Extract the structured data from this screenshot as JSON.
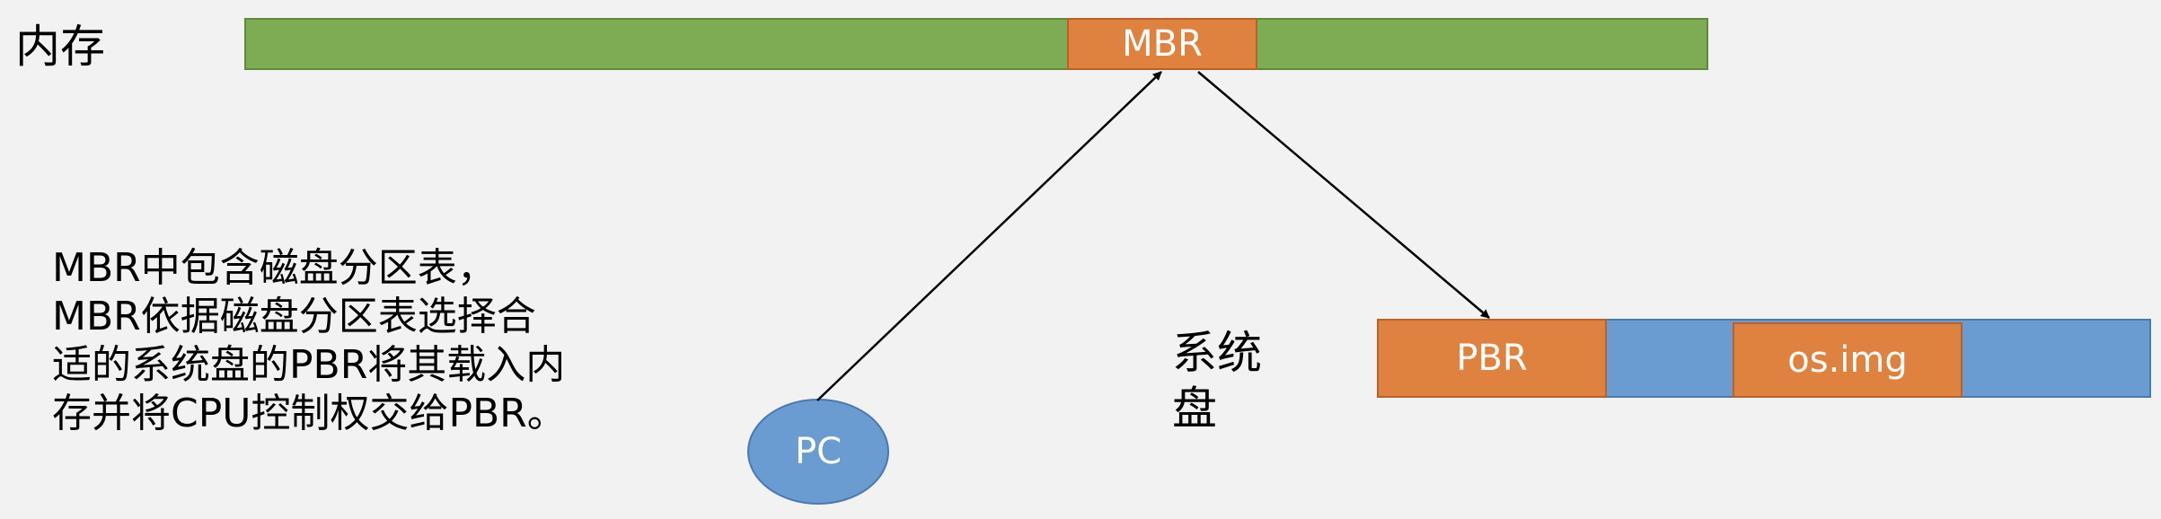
{
  "memory": {
    "label": "内存"
  },
  "mbr": {
    "label": "MBR"
  },
  "disk": {
    "label": "系统盘"
  },
  "pbr": {
    "label": "PBR"
  },
  "os_img": {
    "label": "os.img"
  },
  "pc": {
    "label": "PC"
  },
  "description": {
    "lines": [
      "MBR中包含磁盘分区表，",
      "MBR依据磁盘分区表选择合",
      "适的系统盘的PBR将其载入内",
      "存并将CPU控制权交给PBR。"
    ]
  },
  "colors": {
    "background": "#f2f2f2",
    "memory_bar": "#7eac55",
    "block_orange": "#e0823f",
    "disk_bar": "#6a9bd1",
    "pc_node": "#6a9bd1",
    "arrow": "#000000"
  }
}
